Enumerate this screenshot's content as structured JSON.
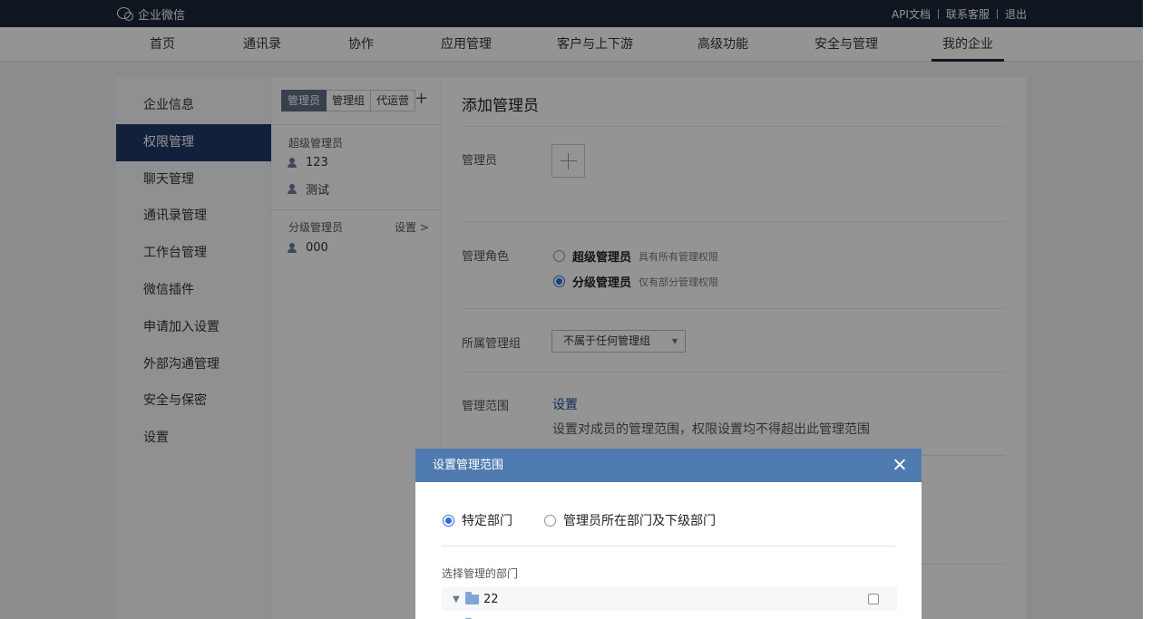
{
  "topbar": {
    "brand": "企业微信",
    "links": [
      "API文档",
      "联系客服",
      "退出"
    ]
  },
  "nav": {
    "items": [
      "首页",
      "通讯录",
      "协作",
      "应用管理",
      "客户与上下游",
      "高级功能",
      "安全与管理",
      "我的企业"
    ],
    "active_index": 7
  },
  "sidebar": {
    "items": [
      "企业信息",
      "权限管理",
      "聊天管理",
      "通讯录管理",
      "工作台管理",
      "微信插件",
      "申请加入设置",
      "外部沟通管理",
      "安全与保密",
      "设置"
    ],
    "active_index": 1
  },
  "admin_panel": {
    "tabs": [
      "管理员",
      "管理组",
      "代运营"
    ],
    "active_tab": 0,
    "add_icon": "plus-icon",
    "super_admin_label": "超级管理员",
    "super_admins": [
      "123",
      "测试"
    ],
    "sub_admin_label": "分级管理员",
    "settings_link": "设置 >",
    "sub_admins": [
      "000"
    ]
  },
  "form": {
    "title": "添加管理员",
    "admin_label": "管理员",
    "role_label": "管理角色",
    "roles": [
      {
        "name": "超级管理员",
        "hint": "具有所有管理权限",
        "checked": false
      },
      {
        "name": "分级管理员",
        "hint": "仅有部分管理权限",
        "checked": true
      }
    ],
    "group_label": "所属管理组",
    "group_select_value": "不属于任何管理组",
    "scope_label": "管理范围",
    "scope_link": "设置",
    "scope_desc": "设置对成员的管理范围，权限设置均不得超出此管理范围"
  },
  "modal": {
    "title": "设置管理范围",
    "options": [
      {
        "label": "特定部门",
        "checked": true
      },
      {
        "label": "管理员所在部门及下级部门",
        "checked": false
      }
    ],
    "section_label": "选择管理的部门",
    "departments": [
      "22",
      ""
    ]
  },
  "colors": {
    "topbar": "#1a2638",
    "active_menu": "#1f3a66",
    "modal_header": "#4f7bb0",
    "link": "#1f4e8c",
    "radio_checked": "#2e6ed1"
  }
}
